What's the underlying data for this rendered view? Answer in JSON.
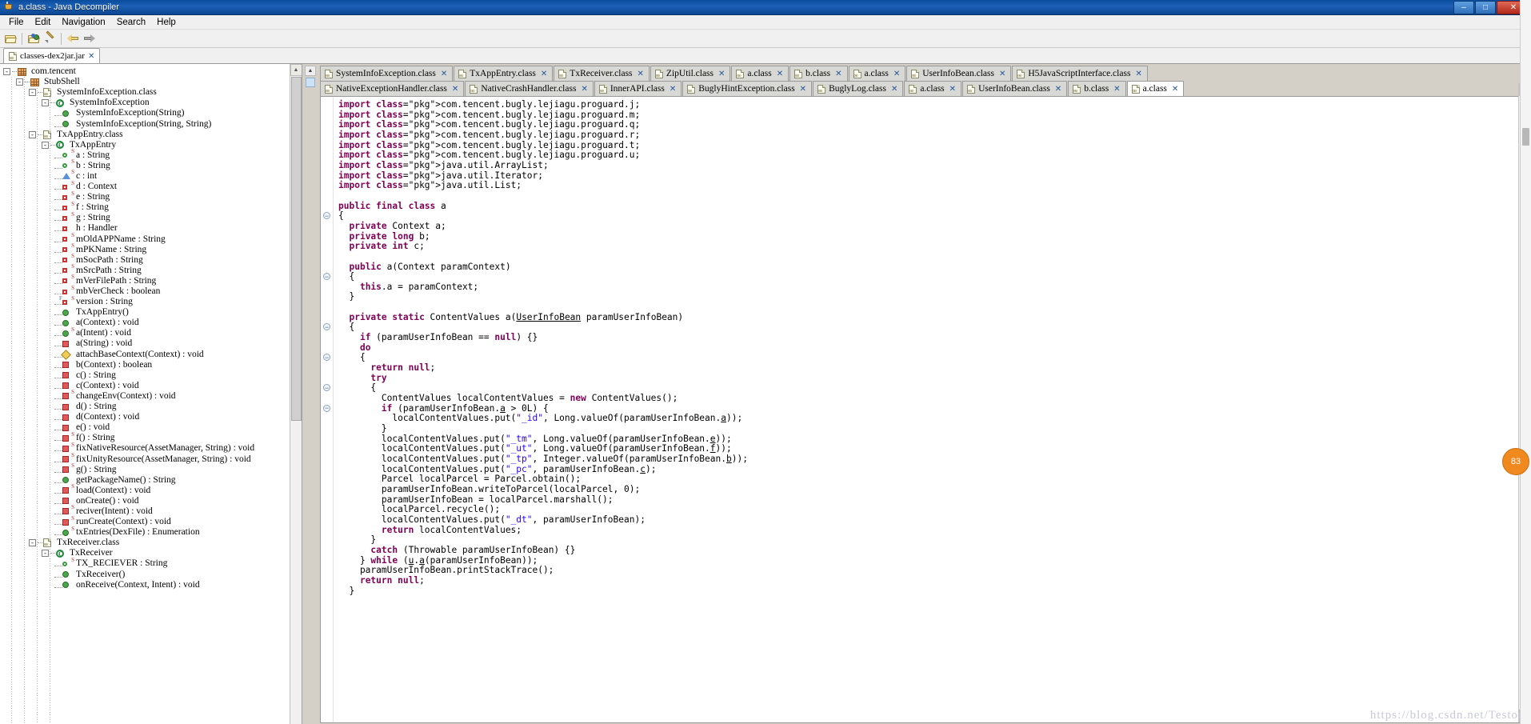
{
  "window": {
    "title": "a.class - Java Decompiler",
    "icon": "java-decompiler-icon",
    "buttons": {
      "minimize": "–",
      "maximize": "□",
      "close": "✕"
    }
  },
  "menubar": {
    "items": [
      "File",
      "Edit",
      "Navigation",
      "Search",
      "Help"
    ]
  },
  "toolbar": {
    "items": [
      {
        "name": "open-file-icon",
        "label": "Open File"
      },
      {
        "name": "open-type-icon",
        "label": "Open Type"
      },
      {
        "name": "save-source-icon",
        "label": "Save Source"
      },
      {
        "name": "navigate-back-icon",
        "label": "Back"
      },
      {
        "name": "navigate-forward-icon",
        "label": "Forward"
      }
    ]
  },
  "jar_tabs": [
    {
      "label": "classes-dex2jar.jar",
      "closer": "✕",
      "active": true
    }
  ],
  "tree": [
    {
      "indent": 0,
      "expander": "-",
      "icon": "package-icon",
      "label": "com.tencent"
    },
    {
      "indent": 1,
      "expander": "-",
      "icon": "package-icon",
      "label": "StubShell"
    },
    {
      "indent": 2,
      "expander": "-",
      "icon": "class-file-icon",
      "label": "SystemInfoException.class"
    },
    {
      "indent": 3,
      "expander": "-",
      "icon": "class-icon",
      "label": "SystemInfoException"
    },
    {
      "indent": 4,
      "expander": "",
      "icon": "method-public-icon",
      "label": "SystemInfoException(String)"
    },
    {
      "indent": 4,
      "expander": "",
      "icon": "method-public-icon",
      "label": "SystemInfoException(String, String)"
    },
    {
      "indent": 2,
      "expander": "-",
      "icon": "class-file-icon",
      "label": "TxAppEntry.class"
    },
    {
      "indent": 3,
      "expander": "-",
      "icon": "class-icon",
      "label": "TxAppEntry"
    },
    {
      "indent": 4,
      "expander": "",
      "icon": "field-public-static-icon",
      "label": "a : String"
    },
    {
      "indent": 4,
      "expander": "",
      "icon": "field-public-static-icon",
      "label": "b : String"
    },
    {
      "indent": 4,
      "expander": "",
      "icon": "field-blue-static-icon",
      "label": "c : int"
    },
    {
      "indent": 4,
      "expander": "",
      "icon": "field-private-static-icon",
      "label": "d : Context"
    },
    {
      "indent": 4,
      "expander": "",
      "icon": "field-private-static-icon",
      "label": "e : String"
    },
    {
      "indent": 4,
      "expander": "",
      "icon": "field-private-static-icon",
      "label": "f : String"
    },
    {
      "indent": 4,
      "expander": "",
      "icon": "field-private-static-icon",
      "label": "g : String"
    },
    {
      "indent": 4,
      "expander": "",
      "icon": "field-private-icon",
      "label": "h : Handler"
    },
    {
      "indent": 4,
      "expander": "",
      "icon": "field-private-static-icon",
      "label": "mOldAPPName : String"
    },
    {
      "indent": 4,
      "expander": "",
      "icon": "field-private-static-icon",
      "label": "mPKName : String"
    },
    {
      "indent": 4,
      "expander": "",
      "icon": "field-private-static-icon",
      "label": "mSocPath : String"
    },
    {
      "indent": 4,
      "expander": "",
      "icon": "field-private-static-icon",
      "label": "mSrcPath : String"
    },
    {
      "indent": 4,
      "expander": "",
      "icon": "field-private-static-icon",
      "label": "mVerFilePath : String"
    },
    {
      "indent": 4,
      "expander": "",
      "icon": "field-private-static-icon",
      "label": "mbVerCheck : boolean"
    },
    {
      "indent": 4,
      "expander": "",
      "icon": "field-final-static-icon",
      "label": "version : String"
    },
    {
      "indent": 4,
      "expander": "",
      "icon": "method-public-icon",
      "label": "TxAppEntry()"
    },
    {
      "indent": 4,
      "expander": "",
      "icon": "method-public-icon",
      "label": "a(Context) : void"
    },
    {
      "indent": 4,
      "expander": "",
      "icon": "method-public-static-icon",
      "label": "a(Intent) : void"
    },
    {
      "indent": 4,
      "expander": "",
      "icon": "method-private-icon",
      "label": "a(String) : void"
    },
    {
      "indent": 4,
      "expander": "",
      "icon": "method-protected-icon",
      "label": "attachBaseContext(Context) : void"
    },
    {
      "indent": 4,
      "expander": "",
      "icon": "method-private-icon",
      "label": "b(Context) : boolean"
    },
    {
      "indent": 4,
      "expander": "",
      "icon": "method-private-icon",
      "label": "c() : String"
    },
    {
      "indent": 4,
      "expander": "",
      "icon": "method-private-icon",
      "label": "c(Context) : void"
    },
    {
      "indent": 4,
      "expander": "",
      "icon": "method-private-static-icon",
      "label": "changeEnv(Context) : void"
    },
    {
      "indent": 4,
      "expander": "",
      "icon": "method-private-icon",
      "label": "d() : String"
    },
    {
      "indent": 4,
      "expander": "",
      "icon": "method-private-icon",
      "label": "d(Context) : void"
    },
    {
      "indent": 4,
      "expander": "",
      "icon": "method-private-icon",
      "label": "e() : void"
    },
    {
      "indent": 4,
      "expander": "",
      "icon": "method-private-static-icon",
      "label": "f() : String"
    },
    {
      "indent": 4,
      "expander": "",
      "icon": "method-private-static-icon",
      "label": "fixNativeResource(AssetManager, String) : void"
    },
    {
      "indent": 4,
      "expander": "",
      "icon": "method-private-static-icon",
      "label": "fixUnityResource(AssetManager, String) : void"
    },
    {
      "indent": 4,
      "expander": "",
      "icon": "method-private-static-icon",
      "label": "g() : String"
    },
    {
      "indent": 4,
      "expander": "",
      "icon": "method-public-icon",
      "label": "getPackageName() : String"
    },
    {
      "indent": 4,
      "expander": "",
      "icon": "method-private-static-icon",
      "label": "load(Context) : void"
    },
    {
      "indent": 4,
      "expander": "",
      "icon": "method-private-icon",
      "label": "onCreate() : void"
    },
    {
      "indent": 4,
      "expander": "",
      "icon": "method-private-static-icon",
      "label": "reciver(Intent) : void"
    },
    {
      "indent": 4,
      "expander": "",
      "icon": "method-private-static-icon",
      "label": "runCreate(Context) : void"
    },
    {
      "indent": 4,
      "expander": "",
      "icon": "method-public-static-icon",
      "label": "txEntries(DexFile) : Enumeration"
    },
    {
      "indent": 2,
      "expander": "-",
      "icon": "class-file-icon",
      "label": "TxReceiver.class"
    },
    {
      "indent": 3,
      "expander": "-",
      "icon": "class-icon",
      "label": "TxReceiver"
    },
    {
      "indent": 4,
      "expander": "",
      "icon": "field-public-static-icon",
      "label": "TX_RECIEVER : String"
    },
    {
      "indent": 4,
      "expander": "",
      "icon": "method-public-icon",
      "label": "TxReceiver()"
    },
    {
      "indent": 4,
      "expander": "",
      "icon": "method-public-icon",
      "label": "onReceive(Context, Intent) : void"
    }
  ],
  "editor_tabs_row1": [
    {
      "label": "SystemInfoException.class",
      "closer": "✕",
      "active": false
    },
    {
      "label": "TxAppEntry.class",
      "closer": "✕",
      "active": false
    },
    {
      "label": "TxReceiver.class",
      "closer": "✕",
      "active": false
    },
    {
      "label": "ZipUtil.class",
      "closer": "✕",
      "active": false
    },
    {
      "label": "a.class",
      "closer": "✕",
      "active": false
    },
    {
      "label": "b.class",
      "closer": "✕",
      "active": false
    },
    {
      "label": "a.class",
      "closer": "✕",
      "active": false
    },
    {
      "label": "UserInfoBean.class",
      "closer": "✕",
      "active": false
    },
    {
      "label": "H5JavaScriptInterface.class",
      "closer": "✕",
      "active": false
    }
  ],
  "editor_tabs_row2": [
    {
      "label": "NativeExceptionHandler.class",
      "closer": "✕",
      "active": false
    },
    {
      "label": "NativeCrashHandler.class",
      "closer": "✕",
      "active": false
    },
    {
      "label": "InnerAPI.class",
      "closer": "✕",
      "active": false
    },
    {
      "label": "BuglyHintException.class",
      "closer": "✕",
      "active": false
    },
    {
      "label": "BuglyLog.class",
      "closer": "✕",
      "active": false
    },
    {
      "label": "a.class",
      "closer": "✕",
      "active": false
    },
    {
      "label": "UserInfoBean.class",
      "closer": "✕",
      "active": false
    },
    {
      "label": "b.class",
      "closer": "✕",
      "active": false
    },
    {
      "label": "a.class",
      "closer": "✕",
      "active": true
    }
  ],
  "code": {
    "language": "java",
    "lines": [
      "import com.tencent.bugly.lejiagu.proguard.j;",
      "import com.tencent.bugly.lejiagu.proguard.m;",
      "import com.tencent.bugly.lejiagu.proguard.q;",
      "import com.tencent.bugly.lejiagu.proguard.r;",
      "import com.tencent.bugly.lejiagu.proguard.t;",
      "import com.tencent.bugly.lejiagu.proguard.u;",
      "import java.util.ArrayList;",
      "import java.util.Iterator;",
      "import java.util.List;",
      "",
      "public final class a",
      "{",
      "  private Context a;",
      "  private long b;",
      "  private int c;",
      "",
      "  public a(Context paramContext)",
      "  {",
      "    this.a = paramContext;",
      "  }",
      "",
      "  private static ContentValues a(UserInfoBean paramUserInfoBean)",
      "  {",
      "    if (paramUserInfoBean == null) {}",
      "    do",
      "    {",
      "      return null;",
      "      try",
      "      {",
      "        ContentValues localContentValues = new ContentValues();",
      "        if (paramUserInfoBean.a > 0L) {",
      "          localContentValues.put(\"_id\", Long.valueOf(paramUserInfoBean.a));",
      "        }",
      "        localContentValues.put(\"_tm\", Long.valueOf(paramUserInfoBean.e));",
      "        localContentValues.put(\"_ut\", Long.valueOf(paramUserInfoBean.f));",
      "        localContentValues.put(\"_tp\", Integer.valueOf(paramUserInfoBean.b));",
      "        localContentValues.put(\"_pc\", paramUserInfoBean.c);",
      "        Parcel localParcel = Parcel.obtain();",
      "        paramUserInfoBean.writeToParcel(localParcel, 0);",
      "        paramUserInfoBean = localParcel.marshall();",
      "        localParcel.recycle();",
      "        localContentValues.put(\"_dt\", paramUserInfoBean);",
      "        return localContentValues;",
      "      }",
      "      catch (Throwable paramUserInfoBean) {}",
      "    } while (u.a(paramUserInfoBean));",
      "    paramUserInfoBean.printStackTrace();",
      "    return null;",
      "  }"
    ],
    "fold_rows": [
      11,
      17,
      22,
      25,
      28,
      30
    ]
  },
  "watermark": {
    "text": "https://blog.csdn.net/Testor"
  },
  "float_badge": {
    "text": "83"
  },
  "scrollbar": {
    "up": "▲",
    "down": "▼"
  }
}
